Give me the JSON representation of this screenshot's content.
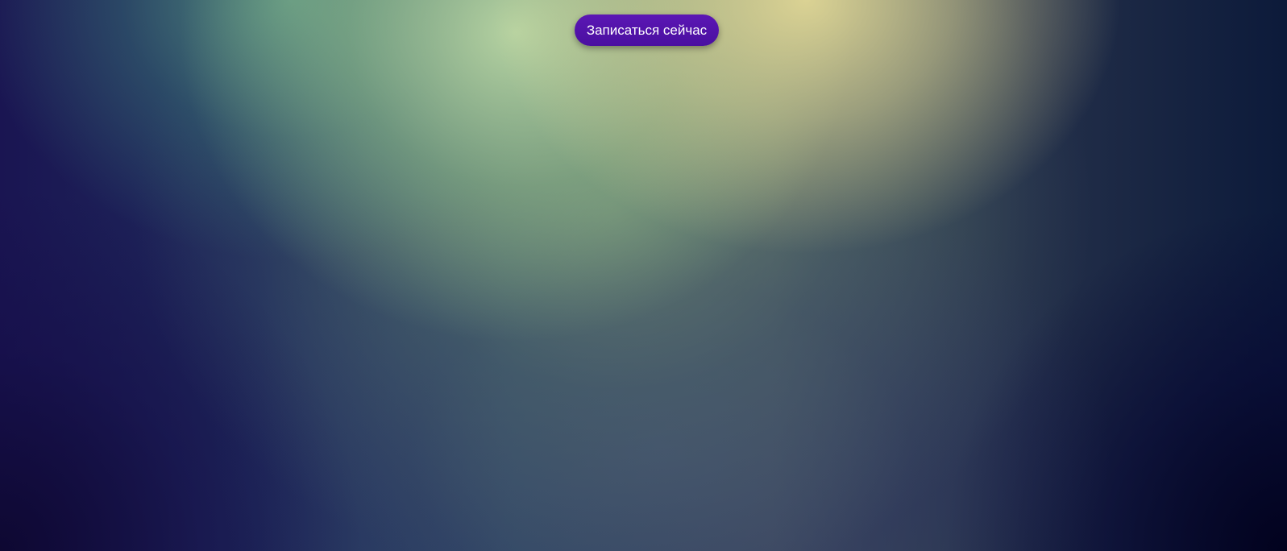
{
  "hero": {
    "cta_label": "Записаться сейчас"
  },
  "colors": {
    "button_bg": "#5217ac",
    "button_text": "#ffffff",
    "glow_yellow": "#dcd68f",
    "glow_green": "#bcd8a4",
    "dark_edge": "#0b0a2e"
  }
}
